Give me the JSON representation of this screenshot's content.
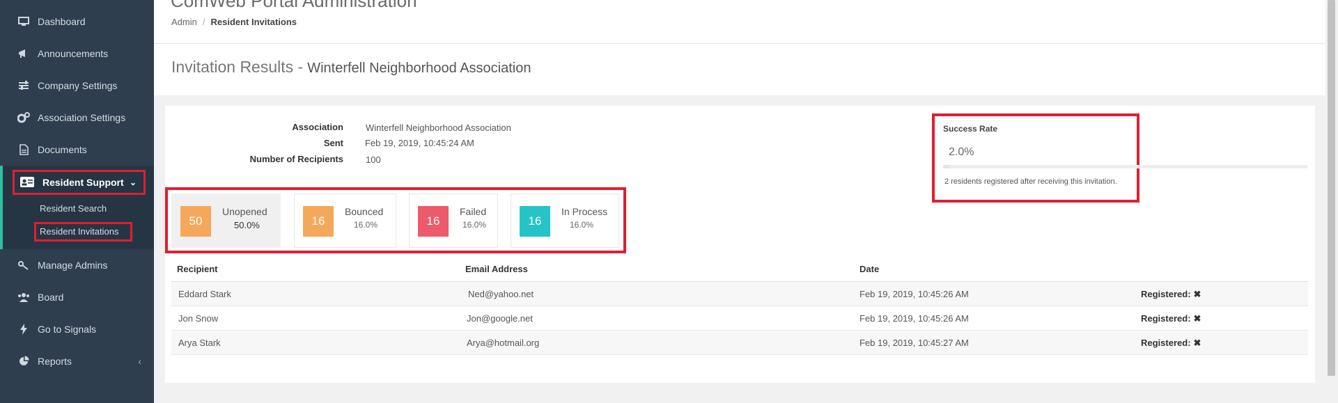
{
  "sidebar": {
    "items": [
      {
        "label": "Dashboard",
        "icon": "monitor-icon"
      },
      {
        "label": "Announcements",
        "icon": "megaphone-icon"
      },
      {
        "label": "Company Settings",
        "icon": "sliders-icon"
      },
      {
        "label": "Association Settings",
        "icon": "gears-icon"
      },
      {
        "label": "Documents",
        "icon": "document-icon"
      },
      {
        "label": "Resident Support",
        "icon": "id-card-icon"
      },
      {
        "label": "Manage Admins",
        "icon": "key-icon"
      },
      {
        "label": "Board",
        "icon": "users-icon"
      },
      {
        "label": "Go to Signals",
        "icon": "bolt-icon"
      },
      {
        "label": "Reports",
        "icon": "pie-chart-icon"
      }
    ],
    "sub_items": [
      "Resident Search",
      "Resident Invitations"
    ]
  },
  "header": {
    "portal_title": "ComWeb Portal Administration",
    "breadcrumb": [
      "Admin",
      "Resident Invitations"
    ]
  },
  "page": {
    "title": "Invitation Results -",
    "subtitle": "Winterfell Neighborhood Association"
  },
  "info": {
    "association_label": "Association",
    "association_value": "Winterfell Neighborhood Association",
    "sent_label": "Sent",
    "sent_value": "Feb 19, 2019, 10:45:24 AM",
    "recipients_label": "Number of Recipients",
    "recipients_value": "100"
  },
  "success": {
    "title": "Success Rate",
    "value": "2.0%",
    "fraction": 0.02,
    "note": "2 residents registered after receiving this invitation."
  },
  "stats": [
    {
      "count": "50",
      "label": "Unopened",
      "pct": "50.0%",
      "color": "#f5a85a"
    },
    {
      "count": "16",
      "label": "Bounced",
      "pct": "16.0%",
      "color": "#f5a85a"
    },
    {
      "count": "16",
      "label": "Failed",
      "pct": "16.0%",
      "color": "#ec5a6b"
    },
    {
      "count": "16",
      "label": "In Process",
      "pct": "16.0%",
      "color": "#26c4c6"
    }
  ],
  "table": {
    "headers": [
      "Recipient",
      "Email Address",
      "Date"
    ],
    "registered_label": "Registered:",
    "rows": [
      {
        "recipient": "Eddard Stark",
        "email": "Ned@yahoo.net",
        "date": "Feb 19, 2019, 10:45:26 AM"
      },
      {
        "recipient": "Jon Snow",
        "email": "Jon@google.net",
        "date": "Feb 19, 2019, 10:45:26 AM"
      },
      {
        "recipient": "Arya Stark",
        "email": "Arya@hotmail.org",
        "date": "Feb 19, 2019, 10:45:27 AM"
      }
    ]
  },
  "colors": {
    "sidebar_bg": "#2e3e4e",
    "accent": "#2fc0a4",
    "highlight": "#e01f2f"
  }
}
